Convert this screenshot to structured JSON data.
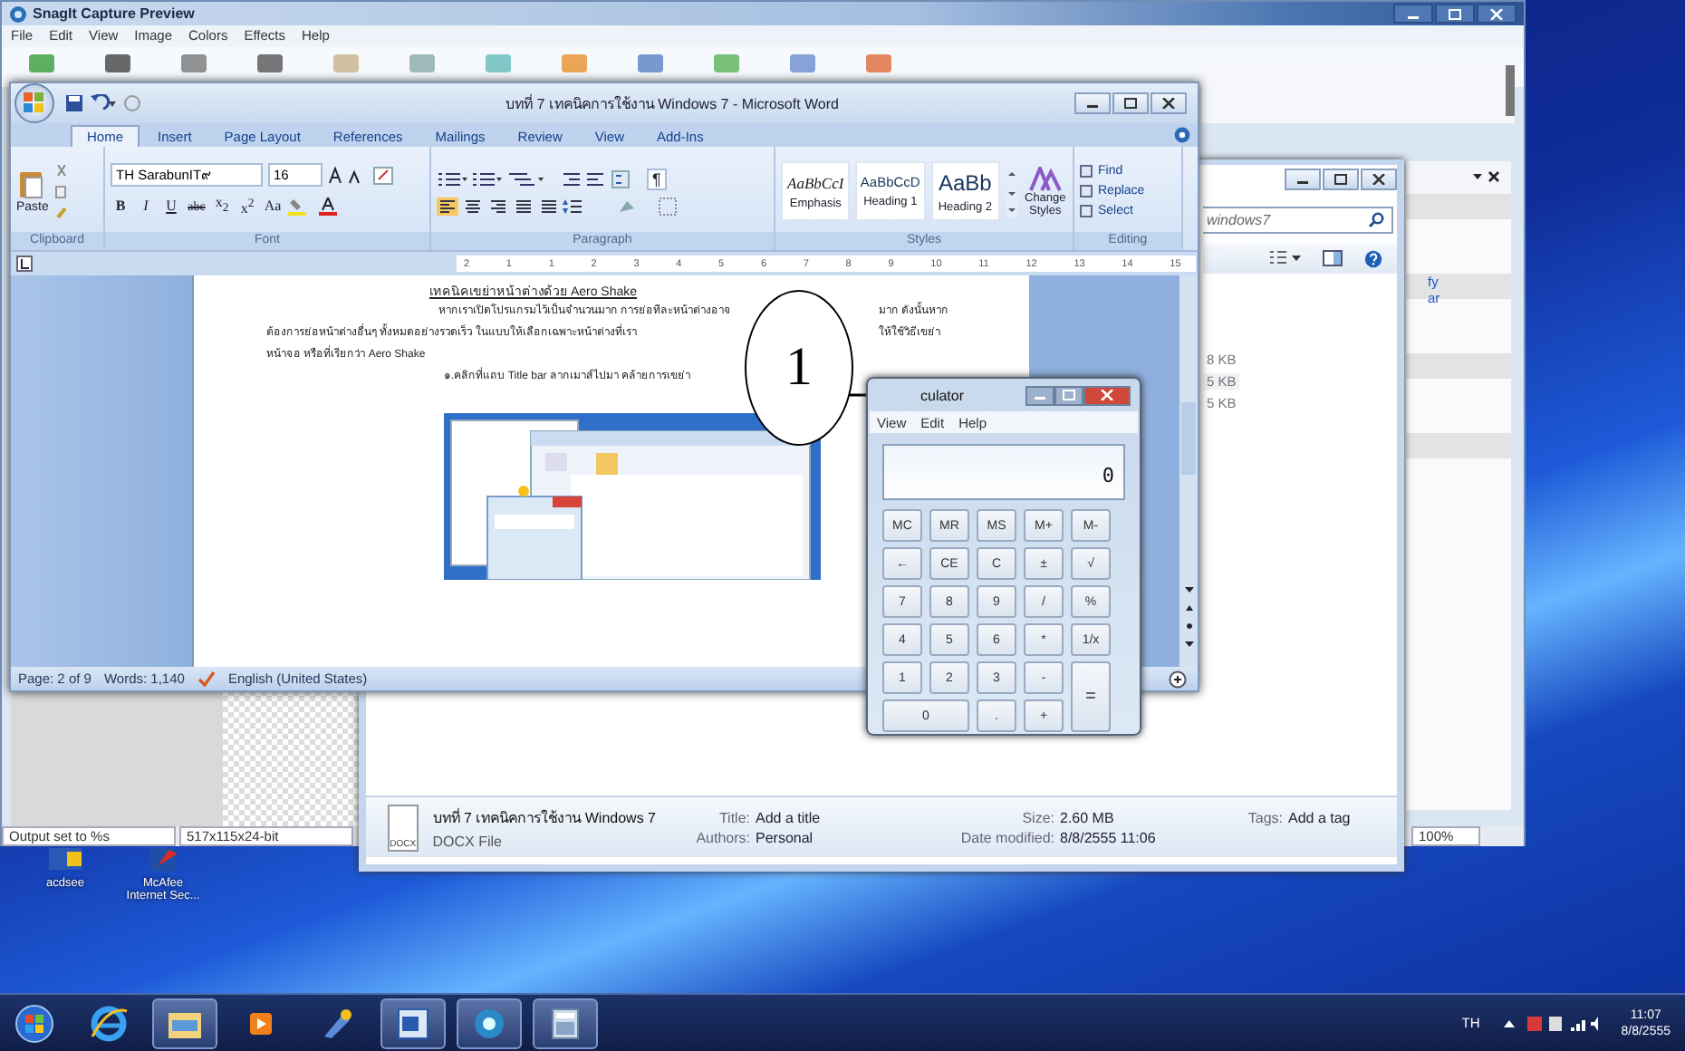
{
  "snagit": {
    "title": "SnagIt Capture Preview",
    "menu": [
      "File",
      "Edit",
      "View",
      "Image",
      "Colors",
      "Effects",
      "Help"
    ],
    "status": [
      "Output set to %s",
      "517x115x24-bit",
      "100%"
    ]
  },
  "explorer": {
    "search_value": "windows7",
    "sizes": [
      "8 KB",
      "5 KB",
      "5 KB"
    ],
    "links": [
      "fy",
      "ar"
    ],
    "details": {
      "icon_label": "DOCX",
      "name": "บทที่ 7 เทคนิคการใช้งาน Windows 7",
      "type": "DOCX File",
      "fields": [
        {
          "label": "Title:",
          "value": "Add a title"
        },
        {
          "label": "Authors:",
          "value": "Personal"
        },
        {
          "label": "Size:",
          "value": "2.60 MB"
        },
        {
          "label": "Date modified:",
          "value": "8/8/2555 11:06"
        },
        {
          "label": "Tags:",
          "value": "Add a tag"
        }
      ]
    }
  },
  "word": {
    "title": "บทที่ 7 เทคนิคการใช้งาน Windows 7 - Microsoft Word",
    "tabs": [
      {
        "label": "Home",
        "selected": true
      },
      {
        "label": "Insert",
        "selected": false
      },
      {
        "label": "Page Layout",
        "selected": false
      },
      {
        "label": "References",
        "selected": false
      },
      {
        "label": "Mailings",
        "selected": false
      },
      {
        "label": "Review",
        "selected": false
      },
      {
        "label": "View",
        "selected": false
      },
      {
        "label": "Add-Ins",
        "selected": false
      }
    ],
    "paste": "Paste",
    "font_name": "TH SarabunIT๙",
    "font_size": "16",
    "font_buttons": [
      "B",
      "I",
      "U",
      "abc",
      "x$_{2}$",
      "x$^{2}$",
      "Aa"
    ],
    "paragraph_mark": "¶",
    "styles": [
      {
        "preview": "AaBbCcI",
        "name": "Emphasis",
        "kind": "italic"
      },
      {
        "preview": "AaBbCcD",
        "name": "Heading 1",
        "kind": "normal"
      },
      {
        "preview": "AaBb",
        "name": "Heading 2",
        "kind": "large"
      }
    ],
    "change_styles": "Change Styles",
    "editing": [
      "Find",
      "Replace",
      "Select"
    ],
    "groups": [
      "Clipboard",
      "Font",
      "Paragraph",
      "Styles",
      "Editing"
    ],
    "ruler": [
      "2",
      "1",
      "1",
      "2",
      "3",
      "4",
      "5",
      "6",
      "7",
      "8",
      "9",
      "10",
      "11",
      "12",
      "13",
      "14",
      "15"
    ],
    "heading": "เทคนิคเขย่าหน้าต่างด้วย Aero Shake",
    "line_1": "หากเราเปิดโปรแกรมไว้เป็นจำนวนมาก การย่อทีละหน้าต่างอาจ",
    "line_1_end": "มาก ดังนั้นหาก",
    "line_2": "ต้องการย่อหน้าต่างอื่นๆ ทั้งหมดอย่างรวดเร็ว ในแบบให้เลือกเฉพาะหน้าต่างที่เรา",
    "line_2_end": "ให้ใช้วิธีเขย่า",
    "line_3": "หน้าจอ หรือที่เรียกว่า Aero Shake",
    "line_4": "๑.คลิกที่แถบ Title bar ลากเมาส์ไปมา คล้ายการเขย่า",
    "status": [
      "Page: 2 of 9",
      "Words: 1,140",
      "English (United States)"
    ]
  },
  "calculator": {
    "title": "culator",
    "menu": [
      "View",
      "Edit",
      "Help"
    ],
    "display": "0",
    "keys": [
      {
        "label": "MC",
        "kind": "normal"
      },
      {
        "label": "MR",
        "kind": "normal"
      },
      {
        "label": "MS",
        "kind": "normal"
      },
      {
        "label": "M+",
        "kind": "normal"
      },
      {
        "label": "M-",
        "kind": "normal"
      },
      {
        "label": "←",
        "kind": "normal"
      },
      {
        "label": "CE",
        "kind": "normal"
      },
      {
        "label": "C",
        "kind": "normal"
      },
      {
        "label": "±",
        "kind": "normal"
      },
      {
        "label": "√",
        "kind": "normal"
      },
      {
        "label": "7",
        "kind": "normal"
      },
      {
        "label": "8",
        "kind": "normal"
      },
      {
        "label": "9",
        "kind": "normal"
      },
      {
        "label": "/",
        "kind": "normal"
      },
      {
        "label": "%",
        "kind": "normal"
      },
      {
        "label": "4",
        "kind": "normal"
      },
      {
        "label": "5",
        "kind": "normal"
      },
      {
        "label": "6",
        "kind": "normal"
      },
      {
        "label": "*",
        "kind": "normal"
      },
      {
        "label": "1/x",
        "kind": "normal"
      },
      {
        "label": "1",
        "kind": "normal"
      },
      {
        "label": "2",
        "kind": "normal"
      },
      {
        "label": "3",
        "kind": "normal"
      },
      {
        "label": "-",
        "kind": "normal"
      },
      {
        "label": "=",
        "kind": "tall"
      },
      {
        "label": "0",
        "kind": "wide"
      },
      {
        "label": ".",
        "kind": "normal"
      },
      {
        "label": "+",
        "kind": "normal"
      }
    ]
  },
  "callout": {
    "label": "1"
  },
  "desktop_icons": [
    {
      "label": "acdsee"
    },
    {
      "label": "McAfee Internet Sec..."
    }
  ],
  "taskbar": {
    "apps": [
      {
        "kind": "ie",
        "running": false
      },
      {
        "kind": "folder",
        "running": true
      },
      {
        "kind": "media",
        "running": false
      },
      {
        "kind": "paint",
        "running": false
      },
      {
        "kind": "word",
        "running": true
      },
      {
        "kind": "snagit",
        "running": true
      },
      {
        "kind": "calculator",
        "running": true
      }
    ],
    "language": "TH",
    "time": "11:07",
    "date": "8/8/2555"
  }
}
